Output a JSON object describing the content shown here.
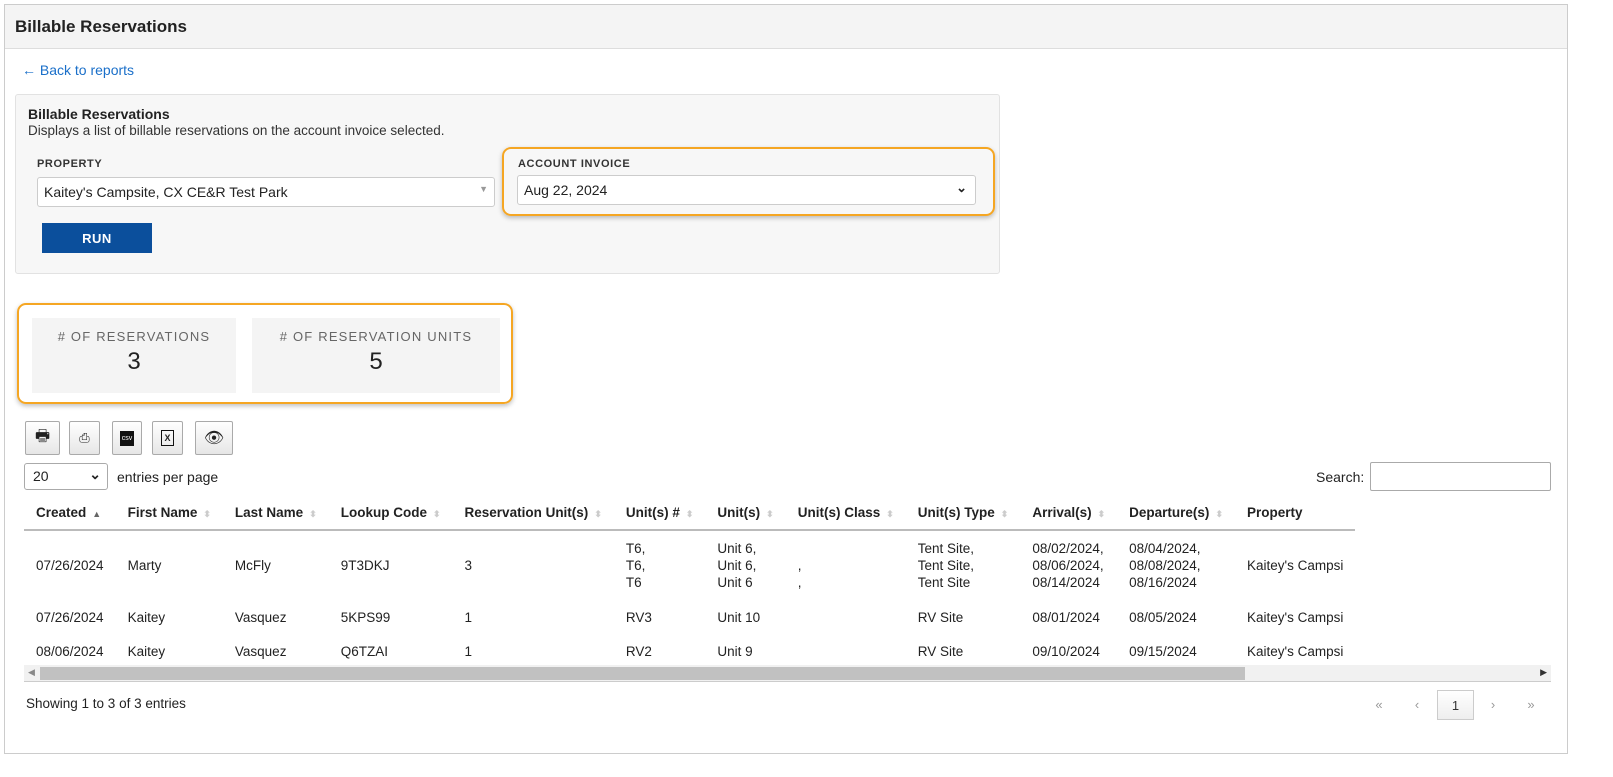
{
  "header": {
    "title": "Billable Reservations"
  },
  "back_link": "← Back to reports",
  "panel": {
    "title": "Billable Reservations",
    "description": "Displays a list of billable reservations on the account invoice selected.",
    "property_label": "PROPERTY",
    "property_value": "Kaitey's Campsite, CX CE&R Test Park",
    "invoice_label": "ACCOUNT INVOICE",
    "invoice_value": "Aug 22, 2024",
    "run_label": "RUN"
  },
  "stats": [
    {
      "label": "# OF RESERVATIONS",
      "value": "3"
    },
    {
      "label": "# OF RESERVATION UNITS",
      "value": "5"
    }
  ],
  "toolbar": [
    "print-icon",
    "pdf-icon",
    "csv-icon",
    "excel-icon",
    "eye-icon"
  ],
  "entries": {
    "value": "20",
    "label": "entries per page"
  },
  "search_label": "Search:",
  "columns": [
    "Created",
    "First Name",
    "Last Name",
    "Lookup Code",
    "Reservation Unit(s)",
    "Unit(s) #",
    "Unit(s)",
    "Unit(s) Class",
    "Unit(s) Type",
    "Arrival(s)",
    "Departure(s)",
    "Property"
  ],
  "rows": [
    [
      "07/26/2024",
      "Marty",
      "McFly",
      "9T3DKJ",
      "3",
      "T6,\nT6,\nT6",
      "Unit 6,\nUnit 6,\nUnit 6",
      "\n,\n,",
      "Tent Site,\nTent Site,\nTent Site",
      "08/02/2024,\n08/06/2024,\n08/14/2024",
      "08/04/2024,\n08/08/2024,\n08/16/2024",
      "Kaitey's Campsi"
    ],
    [
      "07/26/2024",
      "Kaitey",
      "Vasquez",
      "5KPS99",
      "1",
      "RV3",
      "Unit 10",
      "",
      "RV Site",
      "08/01/2024",
      "08/05/2024",
      "Kaitey's Campsi"
    ],
    [
      "08/06/2024",
      "Kaitey",
      "Vasquez",
      "Q6TZAI",
      "1",
      "RV2",
      "Unit 9",
      "",
      "RV Site",
      "09/10/2024",
      "09/15/2024",
      "Kaitey's Campsi"
    ]
  ],
  "footer": {
    "showing": "Showing 1 to 3 of 3 entries",
    "pager": [
      "«",
      "‹",
      "1",
      "›",
      "»"
    ]
  }
}
